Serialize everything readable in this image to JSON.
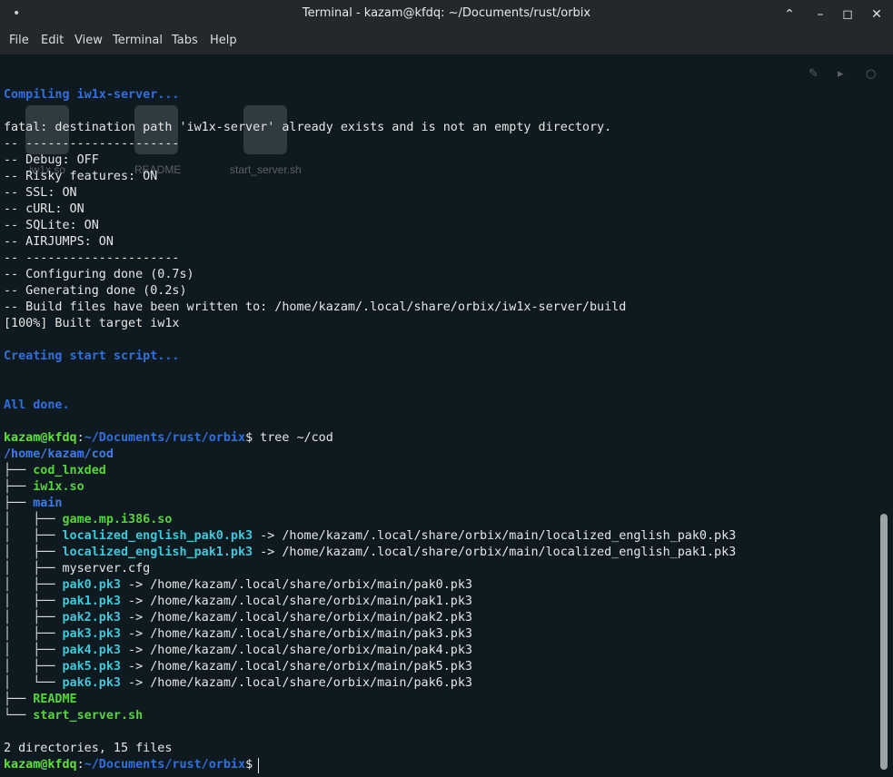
{
  "window": {
    "title": "Terminal - kazam@kfdq: ~/Documents/rust/orbix",
    "controls": [
      "minimize-icon",
      "restore-icon",
      "maximize-icon",
      "close-icon"
    ]
  },
  "menu": [
    "File",
    "Edit",
    "View",
    "Terminal",
    "Tabs",
    "Help"
  ],
  "desktop_overlay": {
    "items": [
      "iw1x.so",
      "README",
      "start_server.sh"
    ]
  },
  "lines": {
    "compiling": "Compiling iw1x-server...",
    "fatal": "fatal: destination path 'iw1x-server' already exists and is not an empty directory.",
    "sep1": "-- ---------------------",
    "debug": "-- Debug: OFF",
    "risky": "-- Risky features: ON",
    "ssl": "-- SSL: ON",
    "curl": "-- cURL: ON",
    "sqlite": "-- SQLite: ON",
    "airjumps": "-- AIRJUMPS: ON",
    "sep2": "-- ---------------------",
    "configuring": "-- Configuring done (0.7s)",
    "generating": "-- Generating done (0.2s)",
    "buildfiles": "-- Build files have been written to: /home/kazam/.local/share/orbix/iw1x-server/build",
    "built": "[100%] Built target iw1x",
    "creating": "Creating start script...",
    "alldone": "All done.",
    "prompt_user": "kazam@kfdq",
    "prompt_colon": ":",
    "prompt_path": "~/Documents/rust/orbix",
    "prompt_dollar": "$",
    "cmd_tree": " tree ~/cod",
    "tree_root": "/home/kazam/cod",
    "summary": "2 directories, 15 files"
  },
  "tree": {
    "cod_lnxded": {
      "branch": "├── ",
      "name": "cod_lnxded"
    },
    "iw1x": {
      "branch": "├── ",
      "name": "iw1x.so"
    },
    "main": {
      "branch": "├── ",
      "name": "main"
    },
    "game": {
      "branch": "│   ├── ",
      "name": "game.mp.i386.so"
    },
    "loc0": {
      "branch": "│   ├── ",
      "name": "localized_english_pak0.pk3",
      "target": " -> /home/kazam/.local/share/orbix/main/localized_english_pak0.pk3"
    },
    "loc1": {
      "branch": "│   ├── ",
      "name": "localized_english_pak1.pk3",
      "target": " -> /home/kazam/.local/share/orbix/main/localized_english_pak1.pk3"
    },
    "cfg": {
      "branch": "│   ├── ",
      "name": "myserver.cfg"
    },
    "pak0": {
      "branch": "│   ├── ",
      "name": "pak0.pk3",
      "target": " -> /home/kazam/.local/share/orbix/main/pak0.pk3"
    },
    "pak1": {
      "branch": "│   ├── ",
      "name": "pak1.pk3",
      "target": " -> /home/kazam/.local/share/orbix/main/pak1.pk3"
    },
    "pak2": {
      "branch": "│   ├── ",
      "name": "pak2.pk3",
      "target": " -> /home/kazam/.local/share/orbix/main/pak2.pk3"
    },
    "pak3": {
      "branch": "│   ├── ",
      "name": "pak3.pk3",
      "target": " -> /home/kazam/.local/share/orbix/main/pak3.pk3"
    },
    "pak4": {
      "branch": "│   ├── ",
      "name": "pak4.pk3",
      "target": " -> /home/kazam/.local/share/orbix/main/pak4.pk3"
    },
    "pak5": {
      "branch": "│   ├── ",
      "name": "pak5.pk3",
      "target": " -> /home/kazam/.local/share/orbix/main/pak5.pk3"
    },
    "pak6": {
      "branch": "│   └── ",
      "name": "pak6.pk3",
      "target": " -> /home/kazam/.local/share/orbix/main/pak6.pk3"
    },
    "readme": {
      "branch": "├── ",
      "name": "README"
    },
    "start": {
      "branch": "└── ",
      "name": "start_server.sh"
    }
  }
}
